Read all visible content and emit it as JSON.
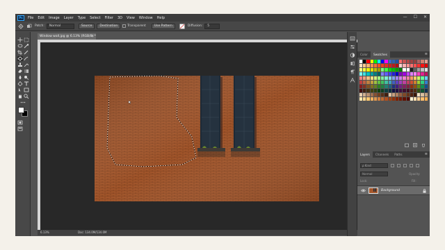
{
  "app": {
    "logo": "Ps"
  },
  "menubar": {
    "items": [
      "File",
      "Edit",
      "Image",
      "Layer",
      "Type",
      "Select",
      "Filter",
      "3D",
      "View",
      "Window",
      "Help"
    ],
    "controls": [
      "—",
      "☐",
      "✕"
    ]
  },
  "options_bar": {
    "patch_label": "Patch:",
    "patch_value": "Normal",
    "source_label": "Source",
    "destination_label": "Destination",
    "transparent_label": "Transparent",
    "use_pattern_label": "Use Pattern",
    "diffusion_label": "Diffusion:",
    "diffusion_value": "5"
  },
  "document": {
    "tab_title": "Window wall.jpg @ 6.13% (RGB/8) *",
    "tab_close": "×"
  },
  "status": {
    "zoom": "6.13%",
    "doc_size": "Doc: 134.0M/134.0M"
  },
  "panels": {
    "color_tabs": [
      "Color",
      "Swatches"
    ],
    "layer_tabs": [
      "Layers",
      "Channels",
      "Paths"
    ],
    "menu_glyph": "≡",
    "kind_filter": "ρ Kind",
    "blend_mode": "Normal",
    "opacity_label": "Opacity:",
    "lock_label": "Lock:",
    "fill_label": "Fill:",
    "layer_name": "Background"
  },
  "swatches": {
    "rows": [
      [
        "#ffffff",
        "#000000",
        "#ff0000",
        "#ffff00",
        "#00ff00",
        "#00ffff",
        "#0000ff",
        "#ff00ff",
        "#3a66c8",
        "#2d5fb0",
        "#1e4fa8",
        "#ff6b6b",
        "#c75050",
        "#b04848",
        "#a04040",
        "#904040",
        "#b06060",
        "#d08070",
        "#e0a090"
      ],
      [
        "#ffe0c0",
        "#ffc890",
        "#ffb070",
        "#ff9050",
        "#ff7030",
        "#ff5020",
        "#f04020",
        "#e03020",
        "#d02020",
        "#c01818",
        "#b01010",
        "#ffd0d0",
        "#ffb0b0",
        "#ff9090",
        "#ff7070",
        "#ff5050",
        "#ff3030",
        "#ff1010",
        "#e00000"
      ],
      [
        "#ffff80",
        "#ffff40",
        "#f0f000",
        "#e0e000",
        "#c0c000",
        "#a0a000",
        "#80ff80",
        "#40ff40",
        "#00e000",
        "#00c000",
        "#00a000",
        "#008000",
        "#ffffff",
        "#ffffff",
        "#202020",
        "#606060",
        "#a0a0a0",
        "#c0c0c0",
        "#e0e0e0"
      ],
      [
        "#80ffff",
        "#40e0e0",
        "#00c0c0",
        "#00a0a0",
        "#008080",
        "#006060",
        "#8080ff",
        "#6060ff",
        "#4040ff",
        "#2020e0",
        "#0000c0",
        "#8000c0",
        "#a000e0",
        "#c040ff",
        "#e080ff",
        "#ff80ff",
        "#ff40c0",
        "#e02090",
        "#c01060"
      ],
      [
        "#f08080",
        "#f0a080",
        "#f0c080",
        "#f0e080",
        "#d0f080",
        "#a0f080",
        "#80f0a0",
        "#80f0d0",
        "#80d0f0",
        "#80a0f0",
        "#a080f0",
        "#d080f0",
        "#f080d0",
        "#f080a0",
        "#ff9966",
        "#ffcc66",
        "#ccff66",
        "#66ff99",
        "#66ccff"
      ],
      [
        "#c04040",
        "#c06040",
        "#c08040",
        "#c0a040",
        "#a0c040",
        "#60c040",
        "#40c060",
        "#40c0a0",
        "#40a0c0",
        "#4060c0",
        "#6040c0",
        "#a040c0",
        "#c040a0",
        "#c04060",
        "#d05030",
        "#d08030",
        "#a0d030",
        "#30d080",
        "#3080d0"
      ],
      [
        "#802020",
        "#803020",
        "#805020",
        "#807020",
        "#608020",
        "#308020",
        "#208040",
        "#208070",
        "#206080",
        "#203080",
        "#402080",
        "#702080",
        "#802060",
        "#802040",
        "#903010",
        "#905010",
        "#609010",
        "#109050",
        "#105090"
      ],
      [
        "#401010",
        "#402010",
        "#403010",
        "#404010",
        "#304010",
        "#104010",
        "#104020",
        "#104040",
        "#103040",
        "#101040",
        "#201040",
        "#401040",
        "#401030",
        "#401020",
        "#502010",
        "#503010",
        "#305010",
        "#105030",
        "#103050"
      ],
      [
        "#e8d0b0",
        "#d0b090",
        "#b89070",
        "#a07050",
        "#885030",
        "#704020",
        "#583018",
        "#402010",
        "#e0c0a0",
        "#c8a080",
        "#b08060",
        "#986040",
        "#804828",
        "#683418",
        "#502410",
        "#381808",
        "#f0e0c0",
        "#d8c0a0",
        "#c0a080"
      ],
      [
        "#ffe8b0",
        "#ffd890",
        "#ffc870",
        "#f0b060",
        "#e09850",
        "#d08040",
        "#c06830",
        "#b05020",
        "#a04010",
        "#903008",
        "#802000",
        "#701800",
        "#601000",
        "#500800",
        "#fff0d0",
        "#ffe0b0",
        "#ffd090",
        "#ffc070",
        "#ffb050"
      ]
    ]
  },
  "canvas": {
    "brick_color": "#a5572b",
    "window_color": "#1e2a36"
  },
  "accent": "#31a8ff"
}
